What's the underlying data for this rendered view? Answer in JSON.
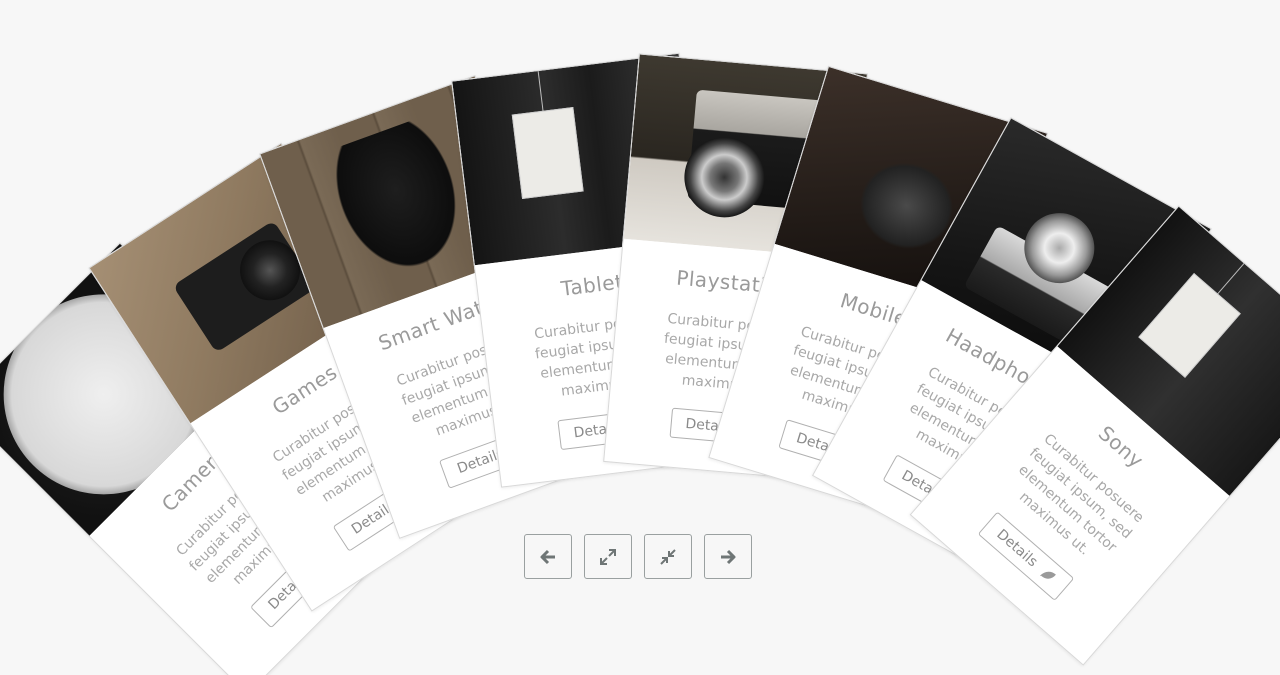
{
  "cards": [
    {
      "title": "Camera",
      "description": "Curabitur posuere feugiat ipsum, sed elementum tortor maximus ut.",
      "button": "Details",
      "image": "vintage-clock"
    },
    {
      "title": "Games",
      "description": "Curabitur posuere feugiat ipsum, sed elementum tortor maximus ut.",
      "button": "Details",
      "image": "person-holding-camera"
    },
    {
      "title": "Smart Watch",
      "description": "Curabitur posuere feugiat ipsum, sed elementum tortor maximus ut.",
      "button": "Details",
      "image": "black-puppy"
    },
    {
      "title": "Tablet",
      "description": "Curabitur posuere feugiat ipsum, sed elementum tortor maximus ut.",
      "button": "Details",
      "image": "paper-lantern"
    },
    {
      "title": "Playstation",
      "description": "Curabitur posuere feugiat ipsum, sed elementum tortor maximus ut.",
      "button": "Details",
      "image": "retro-camera"
    },
    {
      "title": "Mobile",
      "description": "Curabitur posuere feugiat ipsum, sed elementum tortor maximus ut.",
      "button": "Details",
      "image": "machinery"
    },
    {
      "title": "Haadphones",
      "description": "Curabitur posuere feugiat ipsum, sed elementum tortor maximus ut.",
      "button": "Details",
      "image": "fujifilm-camera"
    },
    {
      "title": "Sony",
      "description": "Curabitur posuere feugiat ipsum, sed elementum tortor maximus ut.",
      "button": "Details",
      "image": "paper-lantern"
    }
  ],
  "controls": {
    "prev_icon": "arrow-left-icon",
    "expand_icon": "expand-icon",
    "compress_icon": "compress-icon",
    "next_icon": "arrow-right-icon"
  },
  "colors": {
    "background": "#f7f7f7",
    "card_border": "#d8d8d8",
    "text": "#9a9a9a",
    "button_border": "#9aa0a0"
  }
}
